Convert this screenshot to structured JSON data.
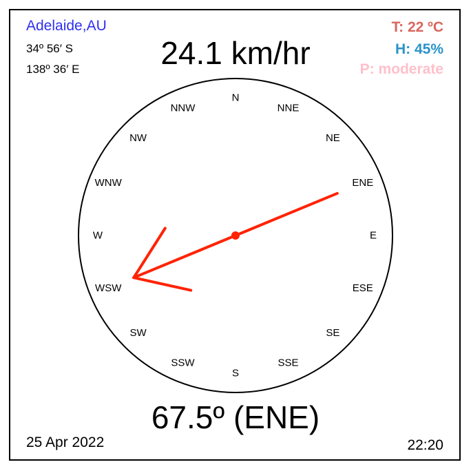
{
  "location": "Adelaide,AU",
  "latitude": "34º 56′ S",
  "longitude": "138º 36′ E",
  "wind_speed": "24.1 km/hr",
  "temperature": "T: 22 ºC",
  "humidity": "H: 45%",
  "pressure": "P: moderate",
  "direction": "67.5º (ENE)",
  "direction_degrees": 67.5,
  "date": "25 Apr 2022",
  "time": "22:20",
  "compass_points": [
    "N",
    "NNE",
    "NE",
    "ENE",
    "E",
    "ESE",
    "SE",
    "SSE",
    "S",
    "SSW",
    "SW",
    "WSW",
    "W",
    "WNW",
    "NW",
    "NNW"
  ],
  "colors": {
    "location": "#2f2ff0",
    "temperature": "#d9665c",
    "humidity": "#2a93c8",
    "pressure": "#ffc0cb",
    "arrow": "#ff2200"
  }
}
